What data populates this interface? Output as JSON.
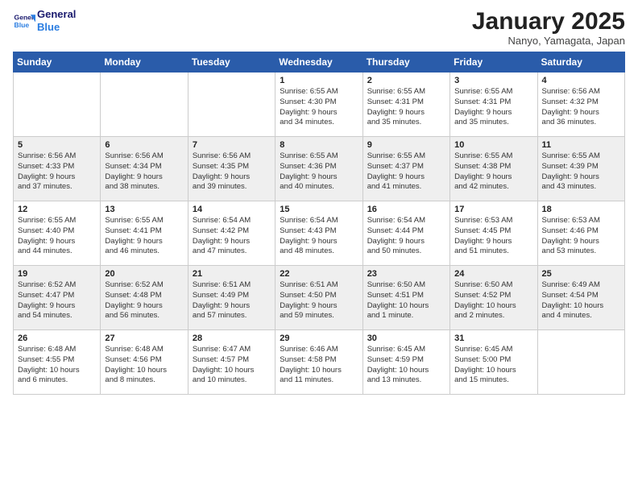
{
  "header": {
    "logo_line1": "General",
    "logo_line2": "Blue",
    "month": "January 2025",
    "location": "Nanyo, Yamagata, Japan"
  },
  "weekdays": [
    "Sunday",
    "Monday",
    "Tuesday",
    "Wednesday",
    "Thursday",
    "Friday",
    "Saturday"
  ],
  "weeks": [
    [
      {
        "day": "",
        "text": ""
      },
      {
        "day": "",
        "text": ""
      },
      {
        "day": "",
        "text": ""
      },
      {
        "day": "1",
        "text": "Sunrise: 6:55 AM\nSunset: 4:30 PM\nDaylight: 9 hours\nand 34 minutes."
      },
      {
        "day": "2",
        "text": "Sunrise: 6:55 AM\nSunset: 4:31 PM\nDaylight: 9 hours\nand 35 minutes."
      },
      {
        "day": "3",
        "text": "Sunrise: 6:55 AM\nSunset: 4:31 PM\nDaylight: 9 hours\nand 35 minutes."
      },
      {
        "day": "4",
        "text": "Sunrise: 6:56 AM\nSunset: 4:32 PM\nDaylight: 9 hours\nand 36 minutes."
      }
    ],
    [
      {
        "day": "5",
        "text": "Sunrise: 6:56 AM\nSunset: 4:33 PM\nDaylight: 9 hours\nand 37 minutes."
      },
      {
        "day": "6",
        "text": "Sunrise: 6:56 AM\nSunset: 4:34 PM\nDaylight: 9 hours\nand 38 minutes."
      },
      {
        "day": "7",
        "text": "Sunrise: 6:56 AM\nSunset: 4:35 PM\nDaylight: 9 hours\nand 39 minutes."
      },
      {
        "day": "8",
        "text": "Sunrise: 6:55 AM\nSunset: 4:36 PM\nDaylight: 9 hours\nand 40 minutes."
      },
      {
        "day": "9",
        "text": "Sunrise: 6:55 AM\nSunset: 4:37 PM\nDaylight: 9 hours\nand 41 minutes."
      },
      {
        "day": "10",
        "text": "Sunrise: 6:55 AM\nSunset: 4:38 PM\nDaylight: 9 hours\nand 42 minutes."
      },
      {
        "day": "11",
        "text": "Sunrise: 6:55 AM\nSunset: 4:39 PM\nDaylight: 9 hours\nand 43 minutes."
      }
    ],
    [
      {
        "day": "12",
        "text": "Sunrise: 6:55 AM\nSunset: 4:40 PM\nDaylight: 9 hours\nand 44 minutes."
      },
      {
        "day": "13",
        "text": "Sunrise: 6:55 AM\nSunset: 4:41 PM\nDaylight: 9 hours\nand 46 minutes."
      },
      {
        "day": "14",
        "text": "Sunrise: 6:54 AM\nSunset: 4:42 PM\nDaylight: 9 hours\nand 47 minutes."
      },
      {
        "day": "15",
        "text": "Sunrise: 6:54 AM\nSunset: 4:43 PM\nDaylight: 9 hours\nand 48 minutes."
      },
      {
        "day": "16",
        "text": "Sunrise: 6:54 AM\nSunset: 4:44 PM\nDaylight: 9 hours\nand 50 minutes."
      },
      {
        "day": "17",
        "text": "Sunrise: 6:53 AM\nSunset: 4:45 PM\nDaylight: 9 hours\nand 51 minutes."
      },
      {
        "day": "18",
        "text": "Sunrise: 6:53 AM\nSunset: 4:46 PM\nDaylight: 9 hours\nand 53 minutes."
      }
    ],
    [
      {
        "day": "19",
        "text": "Sunrise: 6:52 AM\nSunset: 4:47 PM\nDaylight: 9 hours\nand 54 minutes."
      },
      {
        "day": "20",
        "text": "Sunrise: 6:52 AM\nSunset: 4:48 PM\nDaylight: 9 hours\nand 56 minutes."
      },
      {
        "day": "21",
        "text": "Sunrise: 6:51 AM\nSunset: 4:49 PM\nDaylight: 9 hours\nand 57 minutes."
      },
      {
        "day": "22",
        "text": "Sunrise: 6:51 AM\nSunset: 4:50 PM\nDaylight: 9 hours\nand 59 minutes."
      },
      {
        "day": "23",
        "text": "Sunrise: 6:50 AM\nSunset: 4:51 PM\nDaylight: 10 hours\nand 1 minute."
      },
      {
        "day": "24",
        "text": "Sunrise: 6:50 AM\nSunset: 4:52 PM\nDaylight: 10 hours\nand 2 minutes."
      },
      {
        "day": "25",
        "text": "Sunrise: 6:49 AM\nSunset: 4:54 PM\nDaylight: 10 hours\nand 4 minutes."
      }
    ],
    [
      {
        "day": "26",
        "text": "Sunrise: 6:48 AM\nSunset: 4:55 PM\nDaylight: 10 hours\nand 6 minutes."
      },
      {
        "day": "27",
        "text": "Sunrise: 6:48 AM\nSunset: 4:56 PM\nDaylight: 10 hours\nand 8 minutes."
      },
      {
        "day": "28",
        "text": "Sunrise: 6:47 AM\nSunset: 4:57 PM\nDaylight: 10 hours\nand 10 minutes."
      },
      {
        "day": "29",
        "text": "Sunrise: 6:46 AM\nSunset: 4:58 PM\nDaylight: 10 hours\nand 11 minutes."
      },
      {
        "day": "30",
        "text": "Sunrise: 6:45 AM\nSunset: 4:59 PM\nDaylight: 10 hours\nand 13 minutes."
      },
      {
        "day": "31",
        "text": "Sunrise: 6:45 AM\nSunset: 5:00 PM\nDaylight: 10 hours\nand 15 minutes."
      },
      {
        "day": "",
        "text": ""
      }
    ]
  ]
}
